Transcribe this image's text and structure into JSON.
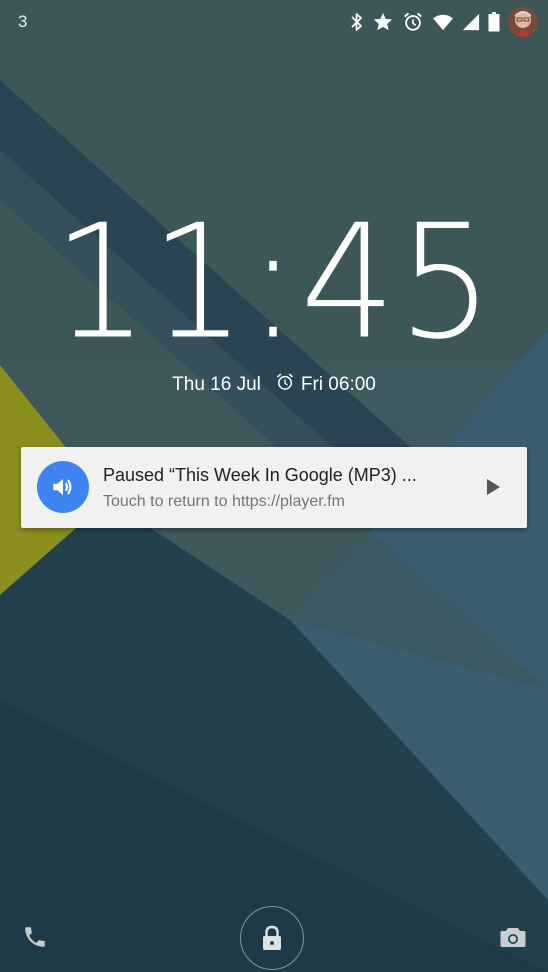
{
  "status_bar": {
    "notification_count": "3",
    "icons": [
      "bluetooth-icon",
      "star-icon",
      "alarm-icon",
      "wifi-icon",
      "cell-signal-icon",
      "battery-icon",
      "avatar"
    ]
  },
  "lockscreen": {
    "time": "11:45",
    "date": "Thu 16 Jul",
    "next_alarm": "Fri 06:00"
  },
  "notification": {
    "icon": "volume-icon",
    "title": "Paused “This Week In Google (MP3) ...",
    "text": "Touch to return to https://player.fm",
    "action_icon": "play-icon",
    "icon_color": "#3d84f0"
  },
  "bottom_bar": {
    "left_icon": "phone-icon",
    "center_icon": "lock-icon",
    "right_icon": "camera-icon"
  },
  "colors": {
    "wallpaper_base": "#2e4a55",
    "wallpaper_accent": "#8a8f1e"
  }
}
